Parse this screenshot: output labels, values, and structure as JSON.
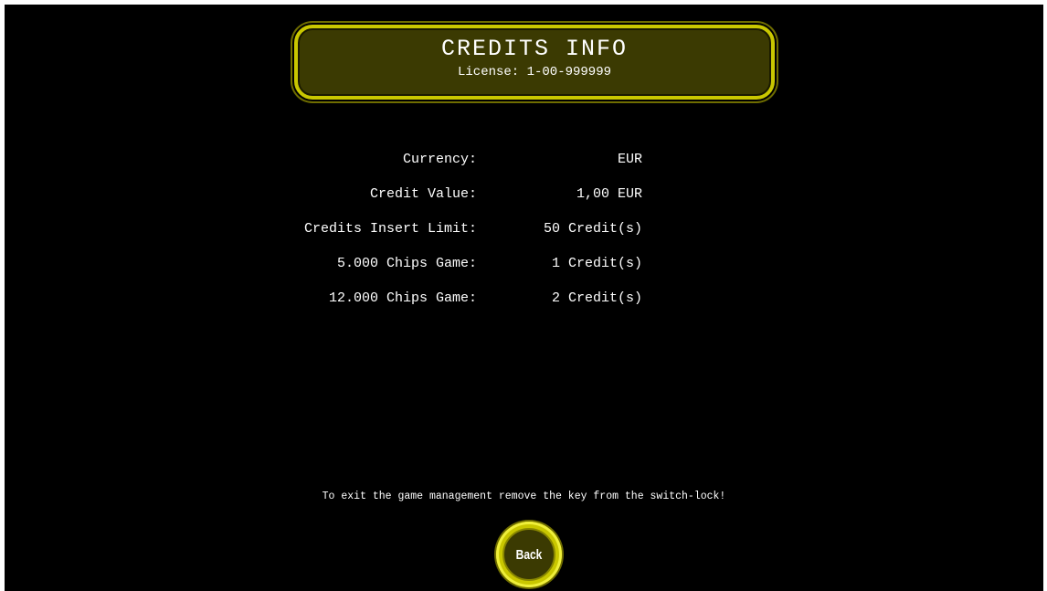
{
  "header": {
    "title": "CREDITS INFO",
    "license": "License: 1-00-999999"
  },
  "info": {
    "rows": [
      {
        "label": "Currency:",
        "value": "EUR"
      },
      {
        "label": "Credit Value:",
        "value": "1,00 EUR"
      },
      {
        "label": "Credits Insert Limit:",
        "value": "50 Credit(s)"
      },
      {
        "label": "5.000 Chips Game:",
        "value": "1 Credit(s)"
      },
      {
        "label": "12.000 Chips Game:",
        "value": "2 Credit(s)"
      }
    ]
  },
  "footer": {
    "exit_note": "To exit the game management remove the key from the switch-lock!",
    "back_label": "Back"
  },
  "colors": {
    "background": "#000000",
    "accent": "#c9c700",
    "panel": "#3b3a02",
    "text": "#ffffff"
  }
}
